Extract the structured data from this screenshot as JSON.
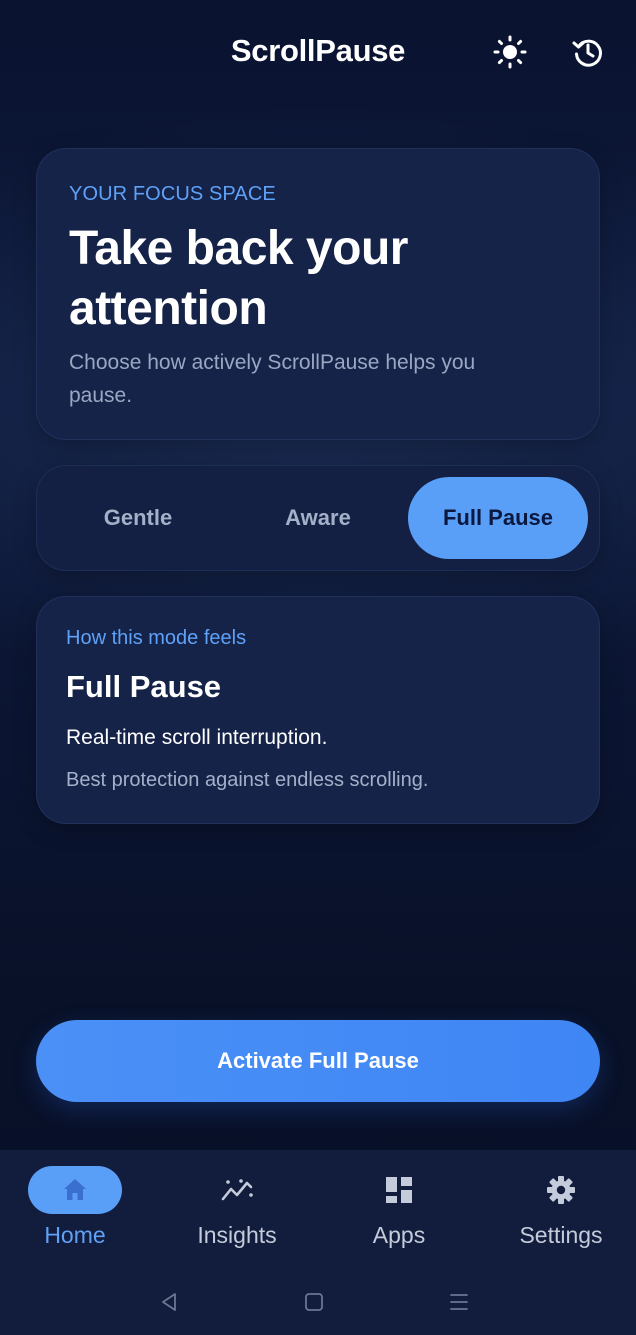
{
  "header": {
    "title": "ScrollPause",
    "theme_icon": "sun-icon",
    "history_icon": "history-icon"
  },
  "hero": {
    "eyebrow": "YOUR FOCUS SPACE",
    "title": "Take back your attention",
    "subtitle": "Choose how actively ScrollPause helps you pause."
  },
  "modes": {
    "options": [
      {
        "label": "Gentle"
      },
      {
        "label": "Aware"
      },
      {
        "label": "Full Pause"
      }
    ],
    "selected": "Full Pause"
  },
  "mode_info": {
    "eyebrow": "How this mode feels",
    "title": "Full Pause",
    "description": "Real-time scroll interruption.",
    "note": "Best protection against endless scrolling."
  },
  "cta": {
    "label": "Activate Full Pause"
  },
  "bottom_nav": {
    "items": [
      {
        "label": "Home",
        "icon": "home-icon",
        "active": true
      },
      {
        "label": "Insights",
        "icon": "insights-icon",
        "active": false
      },
      {
        "label": "Apps",
        "icon": "apps-icon",
        "active": false
      },
      {
        "label": "Settings",
        "icon": "settings-icon",
        "active": false
      }
    ]
  },
  "system_nav": {
    "back_icon": "back-triangle-icon",
    "home_icon": "home-square-icon",
    "menu_icon": "menu-lines-icon"
  },
  "colors": {
    "accent": "#5a9ff7",
    "accent_text": "#5fa1f6",
    "cta": "#4a90f6",
    "card": "#162349",
    "background": "#0b1532"
  }
}
